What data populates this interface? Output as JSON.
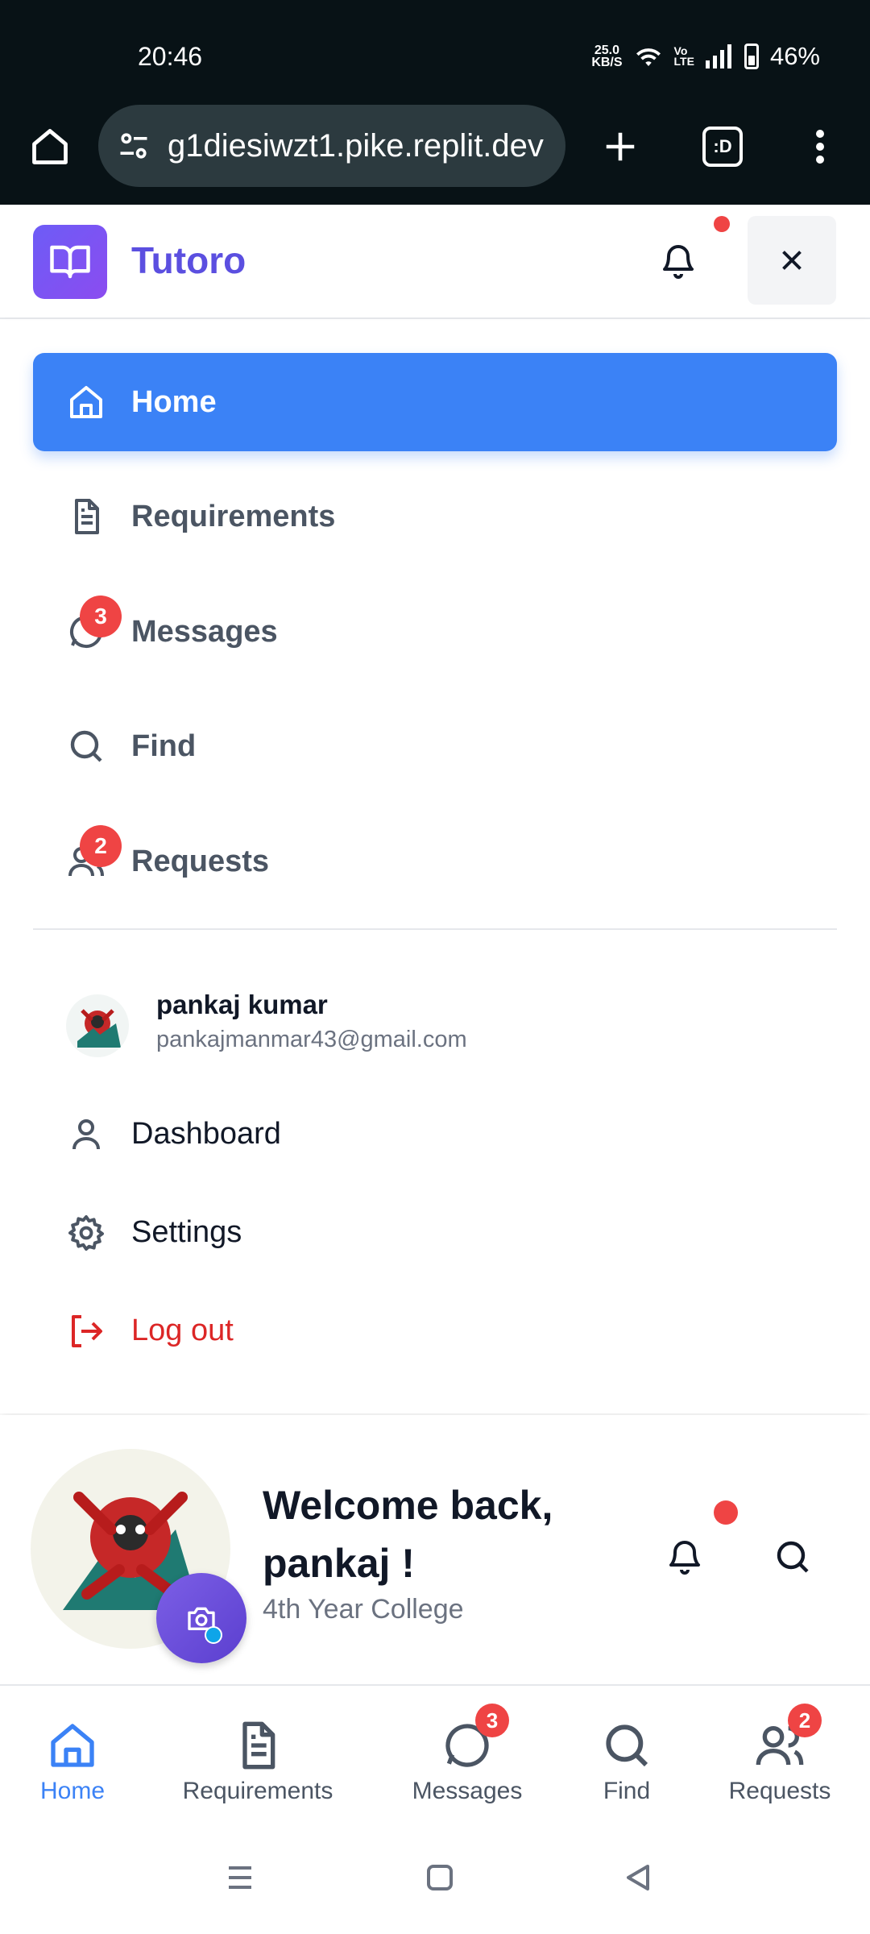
{
  "status_bar": {
    "time": "20:46",
    "net_speed_value": "25.0",
    "net_speed_unit": "KB/S",
    "volte_top": "Vo",
    "volte_bottom": "LTE",
    "battery": "46%"
  },
  "browser": {
    "url": "g1diesiwzt1.pike.replit.dev",
    "tabs_label": ":D"
  },
  "header": {
    "brand": "Tutoro"
  },
  "drawer": {
    "nav": [
      {
        "label": "Home",
        "icon": "home-icon",
        "active": true
      },
      {
        "label": "Requirements",
        "icon": "document-icon"
      },
      {
        "label": "Messages",
        "icon": "chat-icon",
        "badge": "3"
      },
      {
        "label": "Find",
        "icon": "search-icon"
      },
      {
        "label": "Requests",
        "icon": "users-icon",
        "badge": "2"
      }
    ],
    "user": {
      "name": "pankaj kumar",
      "email": "pankajmanmar43@gmail.com"
    },
    "menu": [
      {
        "label": "Dashboard",
        "icon": "user-icon"
      },
      {
        "label": "Settings",
        "icon": "gear-icon"
      },
      {
        "label": "Log out",
        "icon": "logout-icon"
      }
    ]
  },
  "welcome": {
    "title": "Welcome back, pankaj !",
    "subtitle": "4th Year College"
  },
  "bottom_nav": [
    {
      "label": "Home",
      "active": true
    },
    {
      "label": "Requirements"
    },
    {
      "label": "Messages",
      "badge": "3"
    },
    {
      "label": "Find"
    },
    {
      "label": "Requests",
      "badge": "2"
    }
  ],
  "colors": {
    "accent": "#3b82f6",
    "brand": "#5b4fe0",
    "badge": "#ef4444",
    "logout": "#dc2626"
  }
}
